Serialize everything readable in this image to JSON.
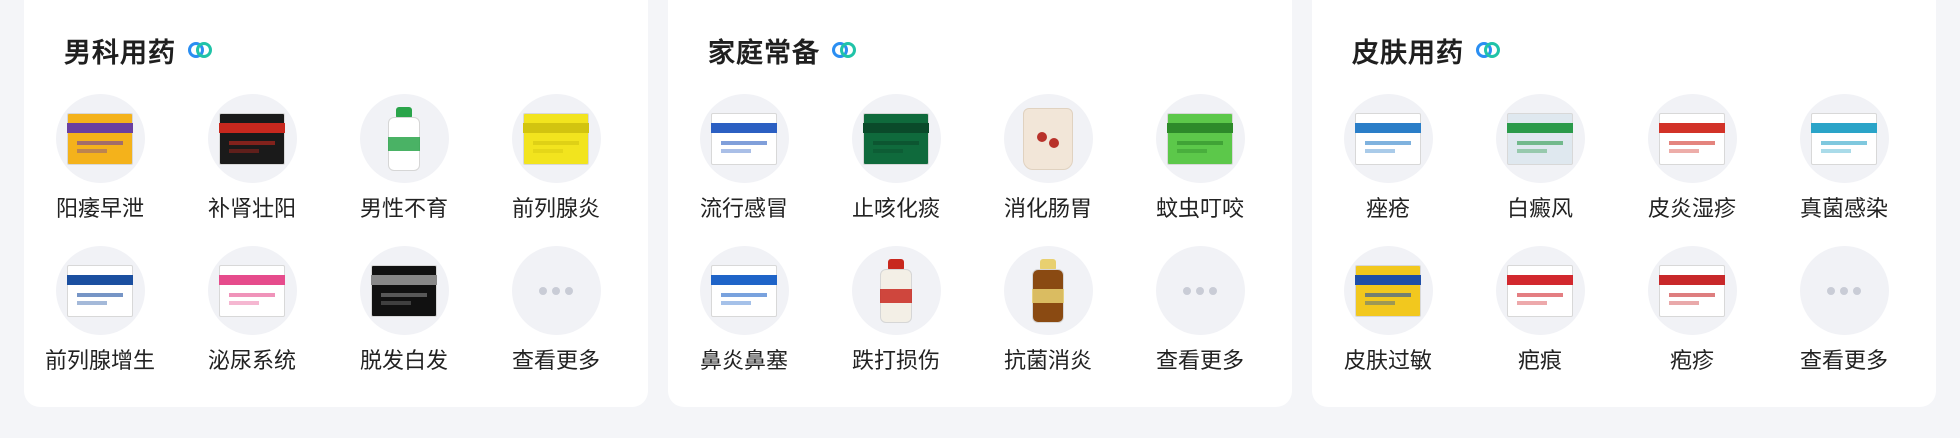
{
  "cards": [
    {
      "title": "男科用药",
      "items": [
        {
          "label": "阳痿早泄",
          "icon": "medicine-box-icon",
          "color": "#f4b21b",
          "accent": "#6a3fa0"
        },
        {
          "label": "补肾壮阳",
          "icon": "medicine-box-icon",
          "color": "#1a1a1a",
          "accent": "#c8281e"
        },
        {
          "label": "男性不育",
          "icon": "medicine-bottle-icon",
          "color": "#ffffff",
          "accent": "#2aa44a"
        },
        {
          "label": "前列腺炎",
          "icon": "medicine-box-icon",
          "color": "#f2e41e",
          "accent": "#d2c410"
        },
        {
          "label": "前列腺增生",
          "icon": "medicine-box-icon",
          "color": "#ffffff",
          "accent": "#1b4fa0"
        },
        {
          "label": "泌尿系统",
          "icon": "medicine-box-icon",
          "color": "#ffffff",
          "accent": "#e64b8c"
        },
        {
          "label": "脱发白发",
          "icon": "medicine-box-icon",
          "color": "#111111",
          "accent": "#888888"
        },
        {
          "label": "查看更多",
          "icon": "more-dots-icon"
        }
      ]
    },
    {
      "title": "家庭常备",
      "items": [
        {
          "label": "流行感冒",
          "icon": "medicine-box-icon",
          "color": "#ffffff",
          "accent": "#2b5fc2"
        },
        {
          "label": "止咳化痰",
          "icon": "medicine-box-icon",
          "color": "#0f6a3c",
          "accent": "#0a4a2a"
        },
        {
          "label": "消化肠胃",
          "icon": "medicine-pouch-icon",
          "color": "#f2e6d8",
          "accent": "#b8322a"
        },
        {
          "label": "蚊虫叮咬",
          "icon": "medicine-box-icon",
          "color": "#5cc84a",
          "accent": "#2d8a2a"
        },
        {
          "label": "鼻炎鼻塞",
          "icon": "medicine-box-icon",
          "color": "#ffffff",
          "accent": "#1f64c8"
        },
        {
          "label": "跌打损伤",
          "icon": "medicine-bottle-icon",
          "color": "#f3efe6",
          "accent": "#c8281e"
        },
        {
          "label": "抗菌消炎",
          "icon": "medicine-bottle-icon",
          "color": "#8a4a12",
          "accent": "#e8d070"
        },
        {
          "label": "查看更多",
          "icon": "more-dots-icon"
        }
      ]
    },
    {
      "title": "皮肤用药",
      "items": [
        {
          "label": "痤疮",
          "icon": "medicine-box-icon",
          "color": "#ffffff",
          "accent": "#2a7ec8"
        },
        {
          "label": "白癜风",
          "icon": "medicine-box-icon",
          "color": "#dfe8ef",
          "accent": "#2a9a4a"
        },
        {
          "label": "皮炎湿疹",
          "icon": "medicine-box-icon",
          "color": "#ffffff",
          "accent": "#d23228"
        },
        {
          "label": "真菌感染",
          "icon": "medicine-box-icon",
          "color": "#ffffff",
          "accent": "#2aa4c8"
        },
        {
          "label": "皮肤过敏",
          "icon": "medicine-box-icon",
          "color": "#f2c81e",
          "accent": "#1f4fa8"
        },
        {
          "label": "疤痕",
          "icon": "medicine-box-icon",
          "color": "#ffffff",
          "accent": "#d2282e"
        },
        {
          "label": "疱疹",
          "icon": "medicine-box-icon",
          "color": "#ffffff",
          "accent": "#c8282a"
        },
        {
          "label": "查看更多",
          "icon": "more-dots-icon"
        }
      ]
    }
  ]
}
